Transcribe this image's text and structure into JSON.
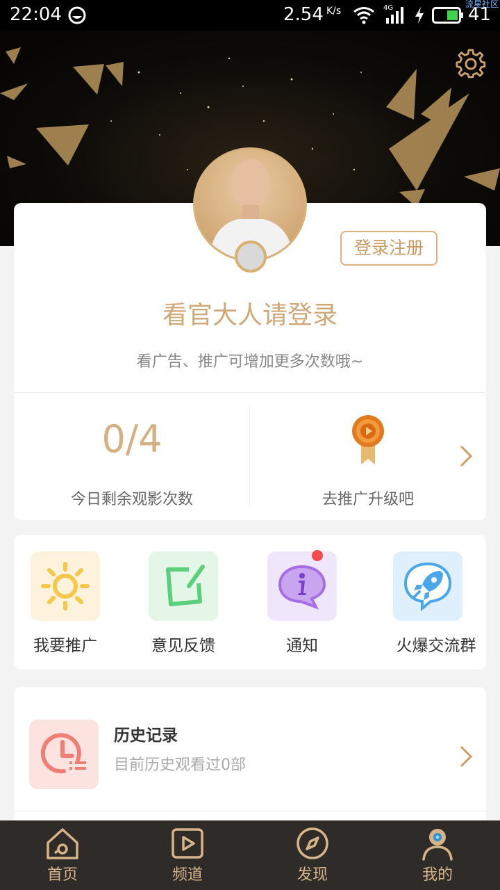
{
  "status_bar": {
    "time": "22:04",
    "speed": "2.54",
    "speed_unit": "K/s",
    "network": "4G",
    "battery_level": "41",
    "watermark": "流星社区"
  },
  "profile": {
    "login_button": "登录注册",
    "prompt": "看官大人请登录",
    "subtitle": "看广告、推广可增加更多次数哦~",
    "views_count": "0/4",
    "views_label": "今日剩余观影次数",
    "promote_label": "去推广升级吧"
  },
  "actions": [
    {
      "label": "我要推广",
      "icon": "sun-icon",
      "color": "#f5c84b"
    },
    {
      "label": "意见反馈",
      "icon": "edit-icon",
      "color": "#5ccf7c"
    },
    {
      "label": "通知",
      "icon": "info-chat-icon",
      "color": "#a56ee6"
    },
    {
      "label": "火爆交流群",
      "icon": "rocket-chat-icon",
      "color": "#4aa7ea"
    }
  ],
  "history": {
    "title": "历史记录",
    "subtitle": "目前历史观看过0部"
  },
  "bottom_nav": [
    {
      "label": "首页",
      "icon": "home-icon"
    },
    {
      "label": "频道",
      "icon": "play-icon"
    },
    {
      "label": "发现",
      "icon": "compass-icon"
    },
    {
      "label": "我的",
      "icon": "user-icon"
    }
  ],
  "colors": {
    "accent": "#d4b182",
    "nav_bg": "#2e2b28"
  }
}
